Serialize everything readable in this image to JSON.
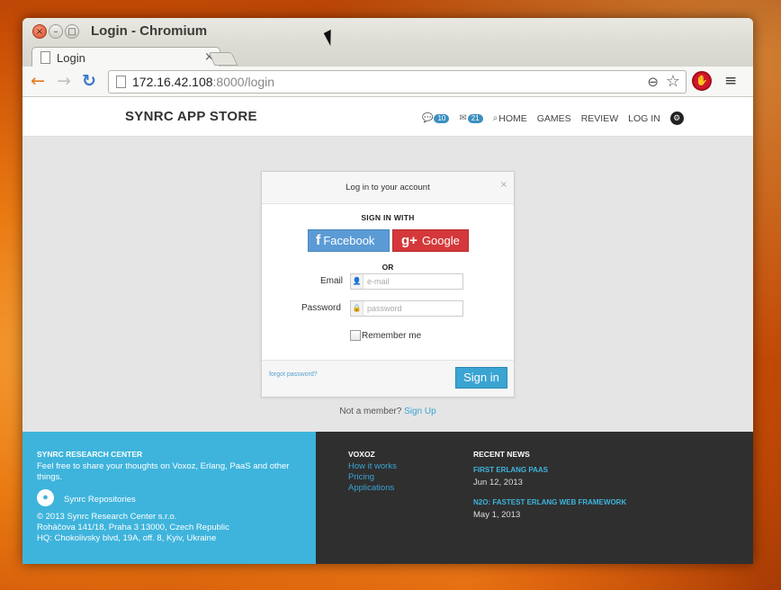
{
  "window": {
    "title": "Login - Chromium",
    "close_glyph": "×",
    "min_glyph": "–",
    "max_glyph": "□"
  },
  "tab": {
    "label": "Login",
    "close_glyph": "×"
  },
  "toolbar": {
    "url_host": "172.16.42.108",
    "url_rest": ":8000/login",
    "back_icon": "←",
    "forward_icon": "→",
    "reload_icon": "↻",
    "zoom_icon": "⊖",
    "star_icon": "☆",
    "ext_icon": "✋",
    "menu_icon": "≡"
  },
  "site": {
    "brand": "SYNRC APP STORE",
    "nav": {
      "messages_count": "10",
      "mail_count": "21",
      "home": "HOME",
      "games": "GAMES",
      "review": "REVIEW",
      "login": "LOG IN"
    }
  },
  "login": {
    "title": "Log in to your account",
    "close_glyph": "×",
    "sign_in_with": "SIGN IN WITH",
    "facebook": {
      "icon": "f",
      "label": "Facebook"
    },
    "google": {
      "icon": "g+",
      "label": "Google"
    },
    "or": "OR",
    "email_label": "Email",
    "email_placeholder": "e-mail",
    "password_label": "Password",
    "password_placeholder": "password",
    "remember": "Remember me",
    "forgot": "forgot password?",
    "submit": "Sign in",
    "not_member": "Not a member?",
    "sign_up": "Sign Up"
  },
  "footer": {
    "left": {
      "title": "SYNRC RESEARCH CENTER",
      "text": "Feel free to share your thoughts on Voxoz, Erlang, PaaS and other things.",
      "repos": "Synrc Repositories",
      "copy1": "© 2013 Synrc Research Center s.r.o.",
      "copy2": "Roháčova 141/18, Praha 3 13000, Czech Republic",
      "copy3": "HQ: Chokolivsky blvd, 19A, off. 8, Kyiv, Ukraine"
    },
    "voxoz": {
      "title": "VOXOZ",
      "links": [
        "How it works",
        "Pricing",
        "Applications"
      ]
    },
    "news": {
      "title": "RECENT NEWS",
      "items": [
        {
          "headline": "FIRST ERLANG PAAS",
          "date": "Jun 12, 2013"
        },
        {
          "headline": "N2O: FASTEST ERLANG WEB FRAMEWORK",
          "date": "May 1, 2013"
        }
      ]
    }
  }
}
